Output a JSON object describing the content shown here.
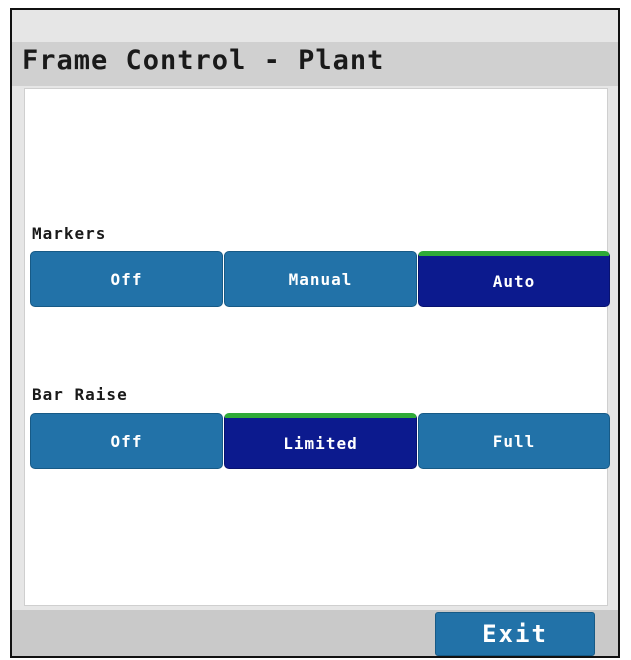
{
  "header": {
    "title": "Frame Control - Plant"
  },
  "markers": {
    "label": "Markers",
    "options": [
      "Off",
      "Manual",
      "Auto"
    ],
    "selected": "Auto"
  },
  "bar_raise": {
    "label": "Bar Raise",
    "options": [
      "Off",
      "Limited",
      "Full"
    ],
    "selected": "Limited"
  },
  "footer": {
    "exit_label": "Exit"
  },
  "colors": {
    "button": "#2272a8",
    "selected": "#0c1a8e",
    "selected_indicator": "#2faa38",
    "title_bar": "#d0d0d0"
  }
}
